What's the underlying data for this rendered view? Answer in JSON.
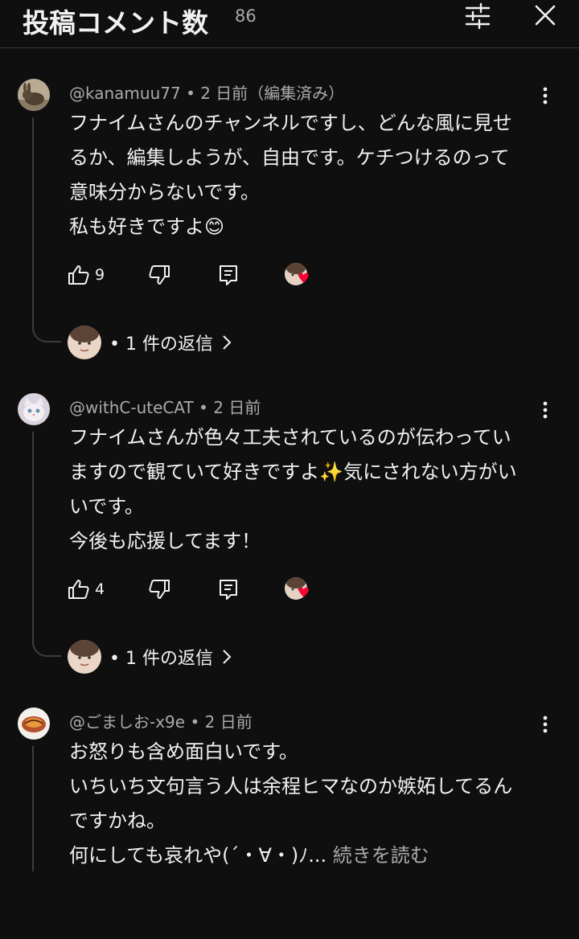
{
  "header": {
    "title": "投稿コメント数",
    "count": "86"
  },
  "comments": [
    {
      "author": "@kanamuu77",
      "sep": "•",
      "time": "2 日前（編集済み）",
      "lines": [
        "フナイムさんのチャンネルですし、どんな風に見せ",
        "るか、編集しようが、自由です。ケチつけるのって",
        "意味分からないです。",
        "私も好きですよ😊"
      ],
      "likes": "9",
      "replies_label": "• 1 件の返信"
    },
    {
      "author": "@withC-uteCAT",
      "sep": "•",
      "time": "2 日前",
      "lines": [
        "フナイムさんが色々工夫されているのが伝わってい",
        "ますので観ていて好きですよ✨気にされない方がい",
        "いです。",
        "今後も応援してます！"
      ],
      "likes": "4",
      "replies_label": "• 1 件の返信"
    },
    {
      "author": "@ごましお-x9e",
      "sep": "•",
      "time": "2 日前",
      "lines": [
        "お怒りも含め面白いです。",
        "いちいち文句言う人は余程ヒマなのか嫉妬してるん",
        "ですかね。"
      ],
      "last_line": "何にしても哀れや(´・∀・)ﾉ...",
      "read_more": "続きを読む"
    }
  ],
  "colors": {
    "background": "#0f0f0f",
    "text": "#f1f1f1",
    "muted": "#aaaaaa",
    "heart": "#ff0033"
  },
  "icons": [
    "filter-icon",
    "close-icon",
    "more-vert-icon",
    "thumb-up-icon",
    "thumb-down-icon",
    "reply-icon",
    "heart-icon",
    "chevron-right-icon"
  ]
}
